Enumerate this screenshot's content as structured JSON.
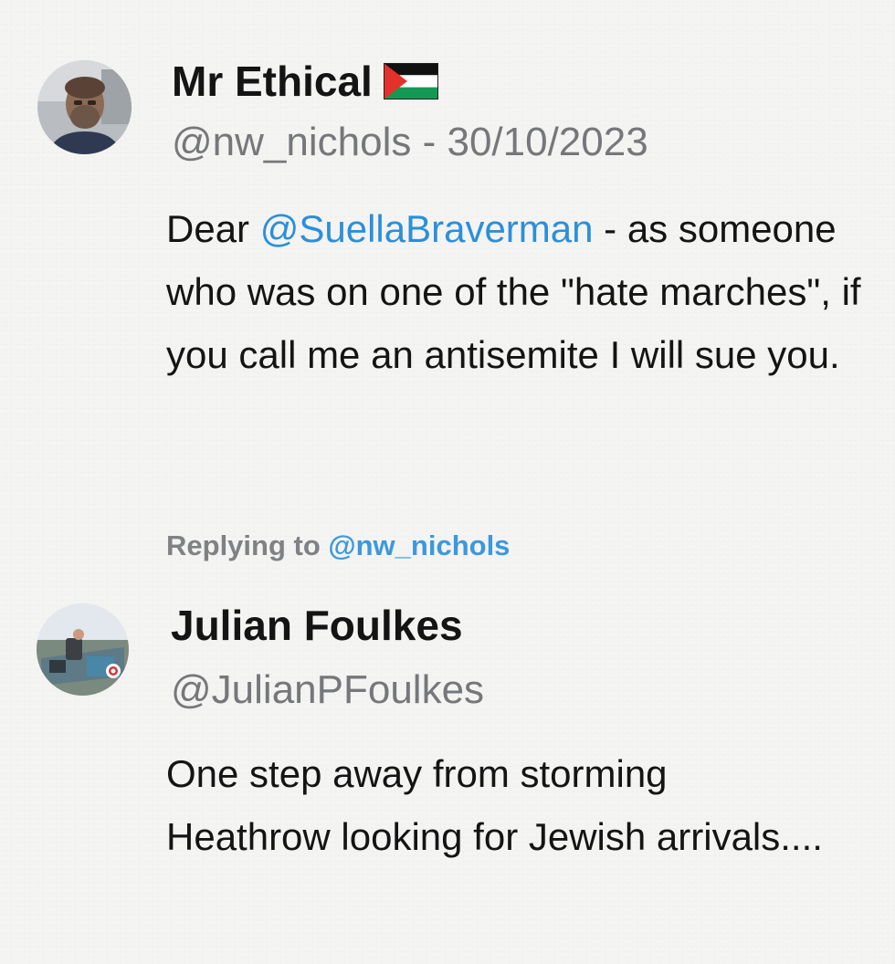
{
  "tweet": {
    "author_name": "Mr Ethical",
    "author_flag": "palestine-flag-icon",
    "handle": "@nw_nichols",
    "separator": " - ",
    "date": "30/10/2023",
    "text_before": "Dear ",
    "mention": "@SuellaBraverman",
    "text_after": " - as someone who was on one of the \"hate marches\", if you call me an antisemite I will sue you."
  },
  "reply": {
    "replying_to_label": "Replying to ",
    "replying_to_handle": "@nw_nichols",
    "author_name": "Julian Foulkes",
    "handle": "@JulianPFoulkes",
    "text": "One step away from storming Heathrow looking for Jewish arrivals...."
  },
  "colors": {
    "mention": "#2c8fd9",
    "secondary_text": "#76777a",
    "primary_text": "#141414",
    "background": "#f4f4f3"
  }
}
